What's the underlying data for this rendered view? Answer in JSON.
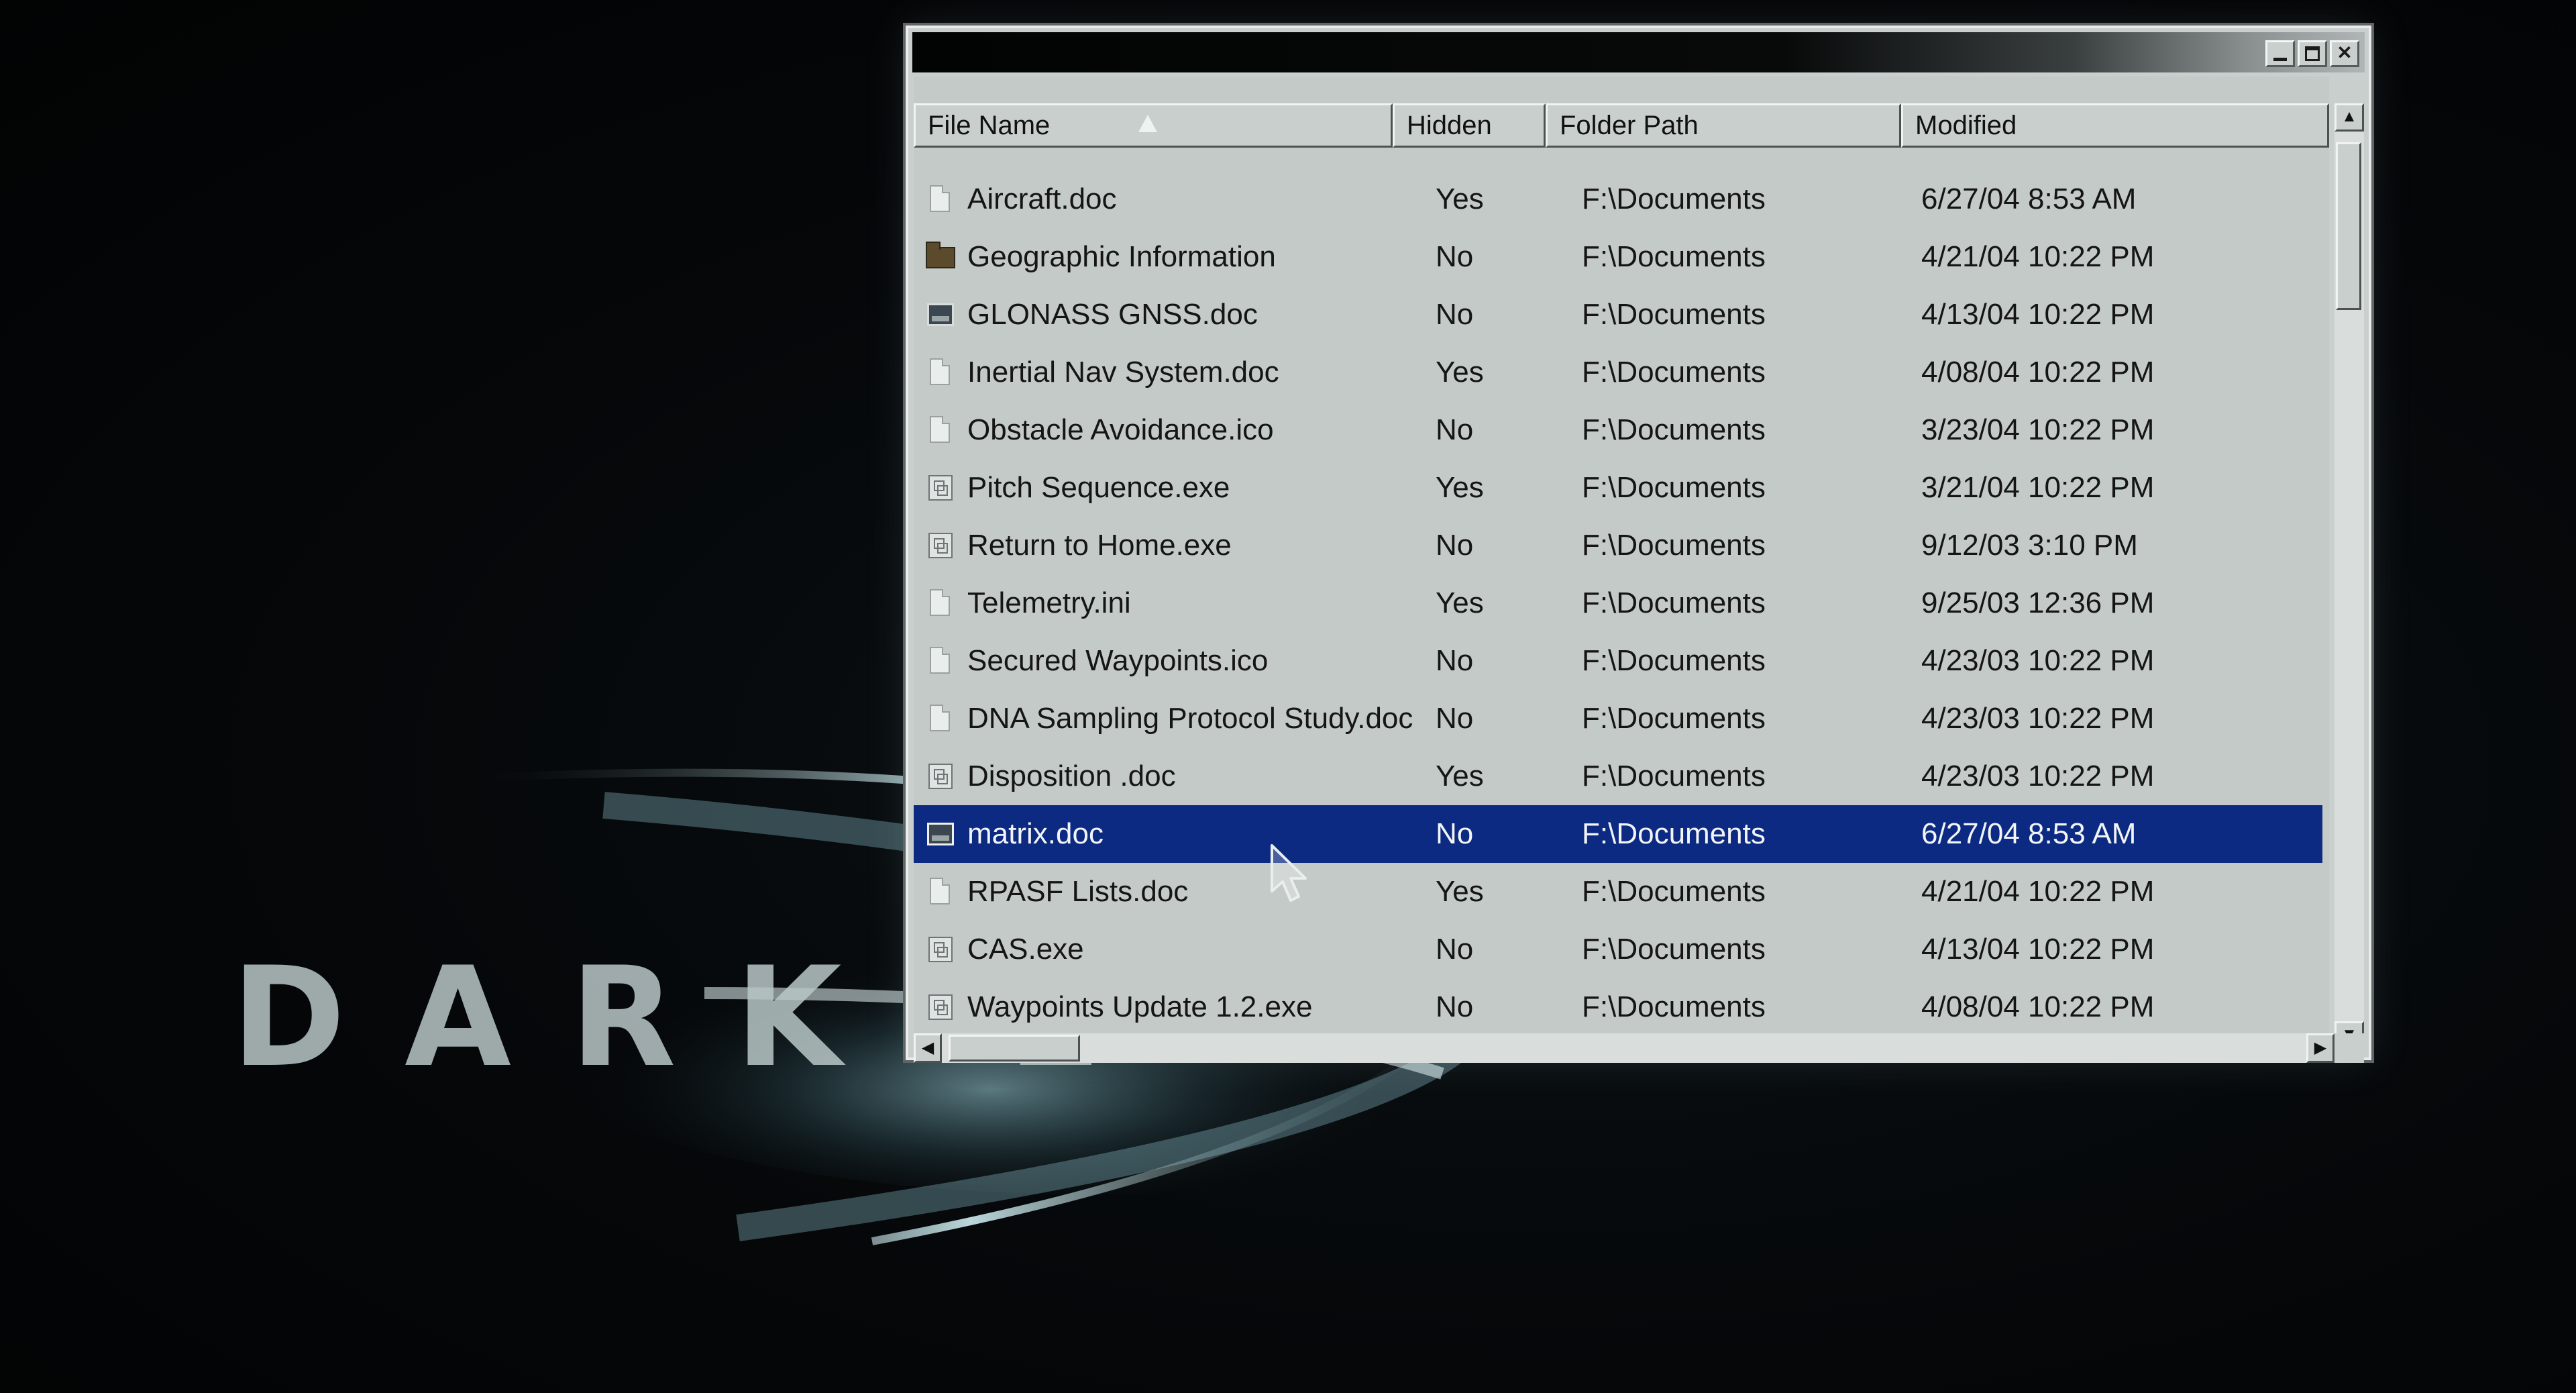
{
  "background": {
    "brand_text": "DARK L",
    "glow_color": "#9fd3dd"
  },
  "window": {
    "title": "",
    "controls": {
      "minimize_icon": "minimize-icon",
      "maximize_icon": "maximize-icon",
      "close_icon": "close-icon",
      "close_glyph": "✕"
    },
    "columns": [
      {
        "label": "File Name",
        "sorted": "ascending"
      },
      {
        "label": "Hidden"
      },
      {
        "label": "Folder Path"
      },
      {
        "label": "Modified"
      }
    ],
    "rows": [
      {
        "icon": "document-icon",
        "name": "Aircraft.doc",
        "hidden": "Yes",
        "path": "F:\\Documents",
        "modified": "6/27/04 8:53 AM"
      },
      {
        "icon": "folder-icon",
        "name": "Geographic Information",
        "hidden": "No",
        "path": "F:\\Documents",
        "modified": "4/21/04 10:22 PM"
      },
      {
        "icon": "image-icon",
        "name": "GLONASS GNSS.doc",
        "hidden": "No",
        "path": "F:\\Documents",
        "modified": "4/13/04 10:22 PM"
      },
      {
        "icon": "document-icon",
        "name": "Inertial Nav System.doc",
        "hidden": "Yes",
        "path": "F:\\Documents",
        "modified": "4/08/04 10:22 PM"
      },
      {
        "icon": "document-icon",
        "name": "Obstacle Avoidance.ico",
        "hidden": "No",
        "path": "F:\\Documents",
        "modified": "3/23/04 10:22 PM"
      },
      {
        "icon": "executable-icon",
        "name": "Pitch Sequence.exe",
        "hidden": "Yes",
        "path": "F:\\Documents",
        "modified": "3/21/04 10:22 PM"
      },
      {
        "icon": "executable-icon",
        "name": "Return to Home.exe",
        "hidden": "No",
        "path": "F:\\Documents",
        "modified": "9/12/03 3:10 PM"
      },
      {
        "icon": "document-icon",
        "name": "Telemetry.ini",
        "hidden": "Yes",
        "path": "F:\\Documents",
        "modified": "9/25/03 12:36 PM"
      },
      {
        "icon": "document-icon",
        "name": "Secured Waypoints.ico",
        "hidden": "No",
        "path": "F:\\Documents",
        "modified": "4/23/03 10:22 PM"
      },
      {
        "icon": "document-icon",
        "name": "DNA Sampling Protocol Study.doc",
        "hidden": "No",
        "path": "F:\\Documents",
        "modified": "4/23/03 10:22 PM"
      },
      {
        "icon": "executable-icon",
        "name": "Disposition .doc",
        "hidden": "Yes",
        "path": "F:\\Documents",
        "modified": "4/23/03 10:22 PM"
      },
      {
        "icon": "image-icon",
        "name": "matrix.doc",
        "hidden": "No",
        "path": "F:\\Documents",
        "modified": "6/27/04 8:53 AM",
        "selected": true
      },
      {
        "icon": "document-icon",
        "name": "RPASF Lists.doc",
        "hidden": "Yes",
        "path": "F:\\Documents",
        "modified": "4/21/04 10:22 PM"
      },
      {
        "icon": "executable-icon",
        "name": "CAS.exe",
        "hidden": "No",
        "path": "F:\\Documents",
        "modified": "4/13/04 10:22 PM"
      },
      {
        "icon": "executable-icon",
        "name": "Waypoints Update 1.2.exe",
        "hidden": "No",
        "path": "F:\\Documents",
        "modified": "4/08/04 10:22 PM"
      }
    ],
    "selection_color": "#0d2a83",
    "scrollbars": {
      "up_glyph": "▲",
      "down_glyph": "▼",
      "left_glyph": "◀",
      "right_glyph": "▶"
    }
  }
}
